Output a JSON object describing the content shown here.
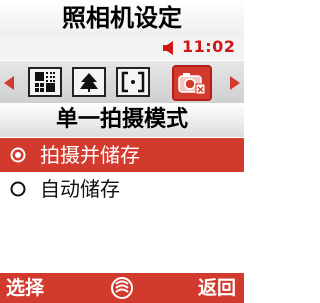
{
  "header": {
    "title": "照相机设定"
  },
  "status": {
    "time": "11:02",
    "icon": "speaker-icon",
    "accent": "#d01818"
  },
  "tabs": [
    {
      "icon": "grid-quality-icon"
    },
    {
      "icon": "scene-mode-icon"
    },
    {
      "icon": "focus-bracket-icon"
    },
    {
      "icon": "camera-settings-icon",
      "active": true
    }
  ],
  "subtitle": "单一拍摄模式",
  "options": [
    {
      "label": "拍摄并储存",
      "selected": true
    },
    {
      "label": "自动储存",
      "selected": false
    }
  ],
  "softkeys": {
    "left": "选择",
    "right": "返回",
    "center_icon": "china-mobile-logo-icon"
  },
  "colors": {
    "accent": "#d33a2e",
    "text": "#111111"
  }
}
